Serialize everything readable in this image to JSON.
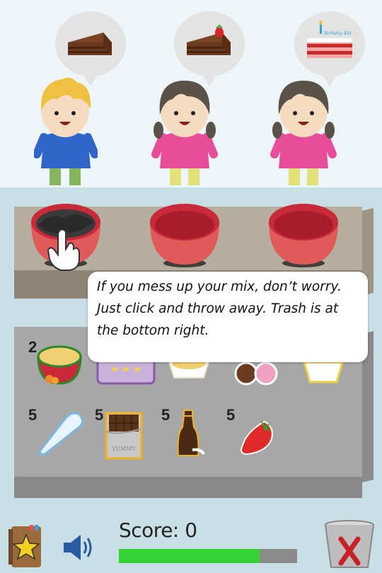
{
  "tooltip": {
    "text": "If you mess up your mix, don’t worry. Just click and throw away. Trash is at the bottom right."
  },
  "customers": [
    {
      "order": "chocolate-cake-slice",
      "character": "boy"
    },
    {
      "order": "strawberry-cake-slice",
      "character": "girl"
    },
    {
      "order": "birthday-cake-slice",
      "character": "girl",
      "cake_text": "Birthday Kid"
    }
  ],
  "bowls": [
    {
      "state": "filled-chocolate-mix"
    },
    {
      "state": "empty"
    },
    {
      "state": "empty"
    }
  ],
  "ingredients": [
    {
      "name": "mixing-bowl",
      "count": "2"
    },
    {
      "name": "baking-tray",
      "count": ""
    },
    {
      "name": "cupcake",
      "count": ""
    },
    {
      "name": "ice-cream-scoops",
      "count": ""
    },
    {
      "name": "cream-bowl",
      "count": ""
    },
    {
      "name": "piping-bag",
      "count": "5"
    },
    {
      "name": "chocolate-bar",
      "count": "5",
      "label": "YUMMY"
    },
    {
      "name": "chocolate-syrup",
      "count": "5"
    },
    {
      "name": "strawberry",
      "count": "5"
    }
  ],
  "hud": {
    "score_text": "Score: 0",
    "progress_fraction": 0.79
  },
  "colors": {
    "progress_fill": "#35d135",
    "bowl": "#e05a5a",
    "trash_x": "#c8202a"
  }
}
